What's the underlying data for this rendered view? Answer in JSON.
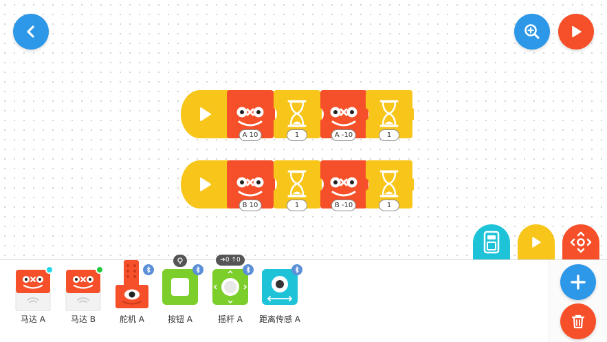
{
  "program": {
    "row1": {
      "params": [
        "A 10",
        "1",
        "A -10",
        "1"
      ]
    },
    "row2": {
      "params": [
        "B 10",
        "1",
        "B -10",
        "1"
      ]
    }
  },
  "tray": {
    "devices": [
      {
        "label": "马达 A",
        "status_color": "#21d6e8"
      },
      {
        "label": "马达 B",
        "status_color": "#22c93a"
      },
      {
        "label": "舵机 A"
      },
      {
        "label": "按钮 A"
      },
      {
        "label": "摇杆 A",
        "readout": "➔0 ↑0"
      },
      {
        "label": "距离传感 A"
      }
    ]
  },
  "colors": {
    "motor_red": "#f5502a",
    "timer_yellow": "#f8c51a",
    "start_yellow": "#f8c51a",
    "button_green": "#7ccf2b",
    "sensor_cyan": "#1ec3d8",
    "accent_blue": "#2d98e8",
    "bluetooth_blue": "#5b8fd8"
  },
  "icons": {
    "back": "chevron-left-icon",
    "zoom": "zoom-in-icon",
    "run": "play-icon",
    "add": "plus-icon",
    "delete": "trash-icon"
  }
}
